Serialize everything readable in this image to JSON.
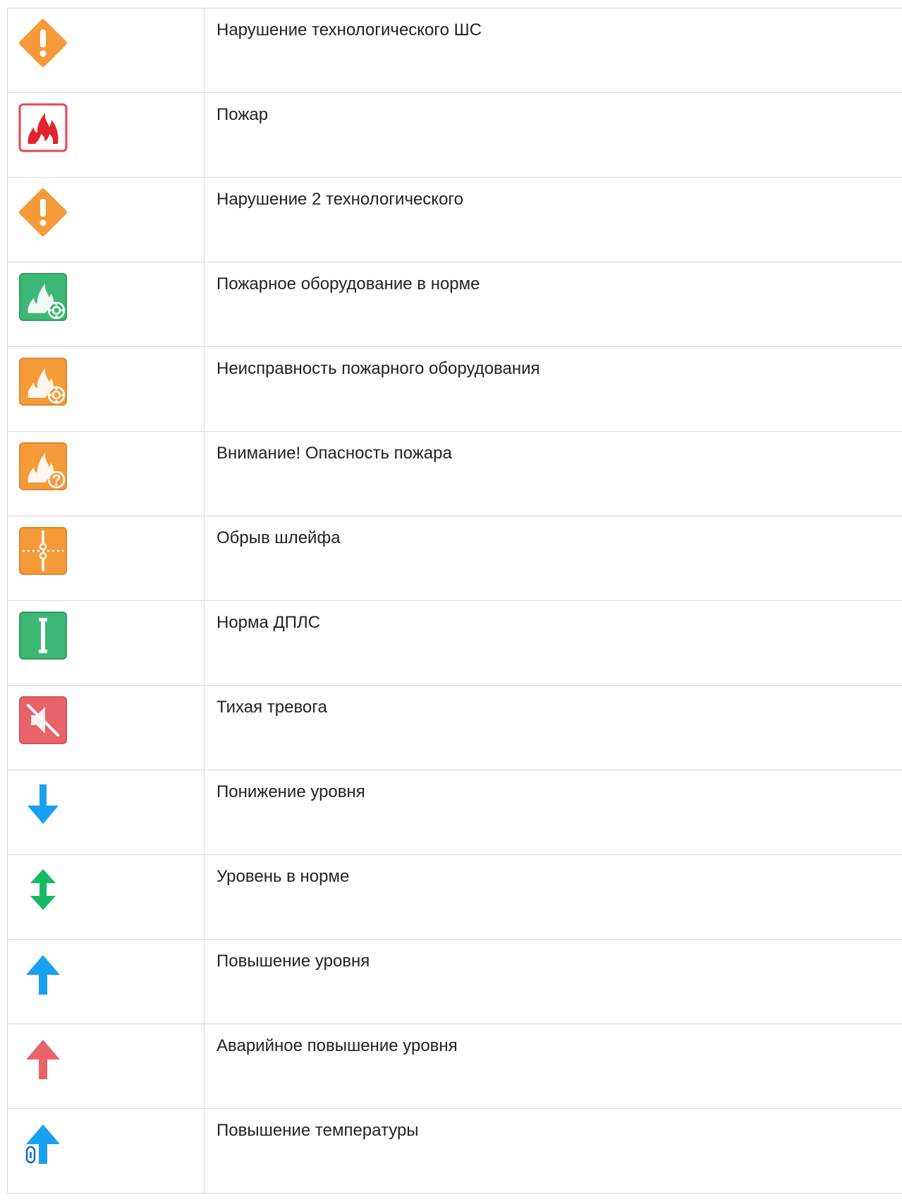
{
  "colors": {
    "orange": "#f59a38",
    "red": "#e8454f",
    "fire_red": "#e2242c",
    "green": "#3db874",
    "blue": "#1aa0f0",
    "dark_blue": "#1565c0",
    "green_arrow": "#17b864",
    "border": "#d6d6d6"
  },
  "rows": [
    {
      "icon": "warning-diamond-icon",
      "label": "Нарушение технологического ШС"
    },
    {
      "icon": "fire-alarm-icon",
      "label": "Пожар"
    },
    {
      "icon": "warning-diamond-icon",
      "label": "Нарушение 2 технологического"
    },
    {
      "icon": "fire-equipment-ok-icon",
      "label": "Пожарное оборудование в норме"
    },
    {
      "icon": "fire-equipment-fault-icon",
      "label": "Неисправность пожарного оборудования"
    },
    {
      "icon": "fire-danger-question-icon",
      "label": "Внимание! Опасность пожара"
    },
    {
      "icon": "loop-break-icon",
      "label": "Обрыв шлейфа"
    },
    {
      "icon": "dpls-normal-icon",
      "label": "Норма ДПЛС"
    },
    {
      "icon": "silent-alarm-icon",
      "label": "Тихая тревога"
    },
    {
      "icon": "arrow-down-icon",
      "label": "Понижение уровня"
    },
    {
      "icon": "arrow-up-down-icon",
      "label": "Уровень в норме"
    },
    {
      "icon": "arrow-up-icon",
      "label": "Повышение уровня"
    },
    {
      "icon": "arrow-up-alarm-icon",
      "label": "Аварийное повышение уровня"
    },
    {
      "icon": "temperature-up-icon",
      "label": "Повышение температуры"
    }
  ]
}
